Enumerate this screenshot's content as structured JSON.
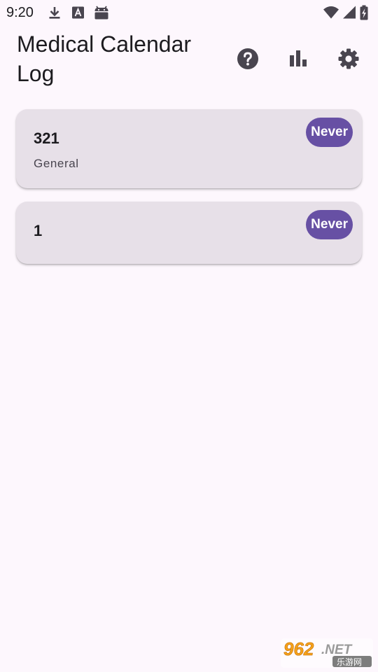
{
  "status_bar": {
    "time": "9:20",
    "icons": [
      "download-icon",
      "font-a-icon",
      "android-icon",
      "wifi-icon",
      "signal-icon",
      "battery-charging-icon"
    ]
  },
  "app_bar": {
    "title": "Medical Calendar Log",
    "actions": [
      "help-icon",
      "bar-chart-icon",
      "settings-gear-icon"
    ]
  },
  "entries": [
    {
      "title": "321",
      "category": "General",
      "badge": "Never"
    },
    {
      "title": "1",
      "category": "",
      "badge": "Never"
    }
  ],
  "colors": {
    "background": "#fdf7fd",
    "card": "#e7e0e8",
    "badge": "#6750a4",
    "icon": "#49454f"
  },
  "watermark": {
    "brand": "962.NET",
    "subtext": "乐游网"
  }
}
